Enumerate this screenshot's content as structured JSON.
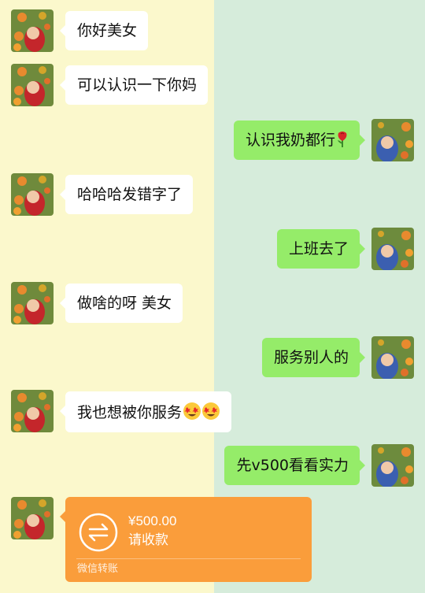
{
  "messages": [
    {
      "side": "in",
      "text": "你好美女"
    },
    {
      "side": "in",
      "text": "可以认识一下你妈"
    },
    {
      "side": "out",
      "text": "认识我奶都行",
      "emoji": "rose-icon"
    },
    {
      "side": "in",
      "text": "哈哈哈发错字了"
    },
    {
      "side": "out",
      "text": "上班去了"
    },
    {
      "side": "in",
      "text": "做啥的呀 美女"
    },
    {
      "side": "out",
      "text": "服务别人的"
    },
    {
      "side": "in",
      "text": "我也想被你服务",
      "emoji": "star-struck-face-icon"
    },
    {
      "side": "out",
      "text": "先v500看看实力"
    }
  ],
  "transfer": {
    "amount": "¥500.00",
    "action": "请收款",
    "footer": "微信转账",
    "icon": "transfer-arrows-icon",
    "color": "#fa9d3b"
  },
  "colors": {
    "left_bg": "#fbf8cc",
    "right_bg": "#d6ecdb",
    "incoming_bubble": "#ffffff",
    "outgoing_bubble": "#95ec69"
  }
}
